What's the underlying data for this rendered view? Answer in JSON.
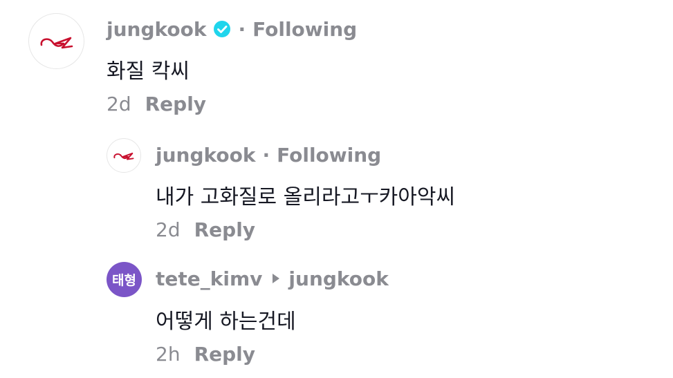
{
  "comments": [
    {
      "username": "jungkook",
      "verified": true,
      "follow_status": "Following",
      "text": "화질 칵씨",
      "time": "2d",
      "reply_label": "Reply"
    },
    {
      "username": "jungkook",
      "verified": false,
      "follow_status": "Following",
      "text": "내가 고화질로 올리라고ㅜ카아악씨",
      "time": "2d",
      "reply_label": "Reply"
    },
    {
      "username": "tete_kimv",
      "avatar_text": "태형",
      "reply_to": "jungkook",
      "text": "어떻게 하는건데",
      "time": "2h",
      "reply_label": "Reply"
    }
  ],
  "colors": {
    "secondary_text": "#8a8b91",
    "primary_text": "#161823",
    "verified_badge": "#20d5ec",
    "avatar_purple": "#7b55c7",
    "logo_red": "#c8102e"
  },
  "icons": {
    "verified": "verified-badge-icon",
    "reply_arrow": "reply-to-arrow-icon",
    "avatar_logo": "jungkook-avatar-logo"
  }
}
